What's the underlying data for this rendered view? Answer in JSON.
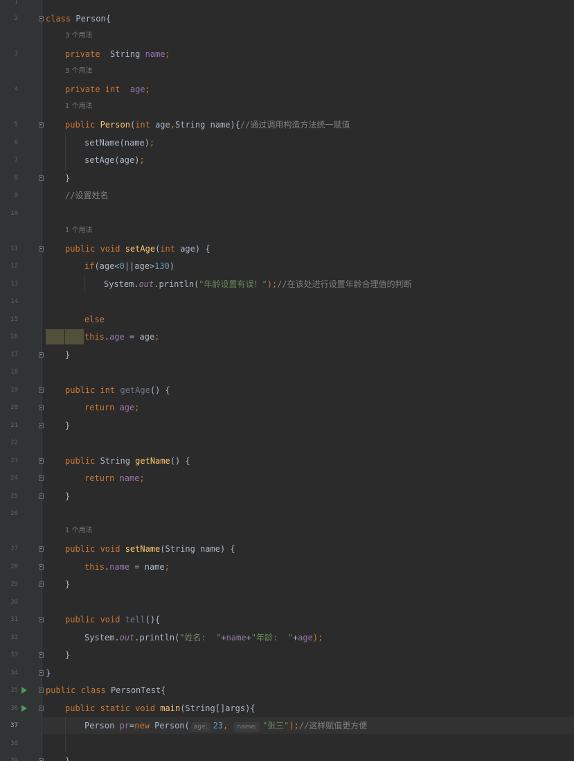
{
  "editor": {
    "current_line": 37,
    "lines": [
      {
        "n": 1
      },
      {
        "n": 2,
        "tokens": [
          {
            "t": "class ",
            "c": "kw"
          },
          {
            "t": "Person{"
          }
        ]
      },
      {
        "n": 3,
        "hint": "3 个用法",
        "tokens": [
          {
            "t": "private  ",
            "c": "kw"
          },
          {
            "t": "String "
          },
          {
            "t": "name",
            "c": "fld"
          },
          {
            "t": ";",
            "c": "kw"
          }
        ]
      },
      {
        "n": 4,
        "hint": "3 个用法",
        "tokens": [
          {
            "t": "private ",
            "c": "kw"
          },
          {
            "t": "int  ",
            "c": "kw"
          },
          {
            "t": "age",
            "c": "fld"
          },
          {
            "t": ";",
            "c": "kw"
          }
        ]
      },
      {
        "n": 5,
        "hint": "1 个用法",
        "tokens": [
          {
            "t": "public ",
            "c": "kw"
          },
          {
            "t": "Person",
            "c": "fn"
          },
          {
            "t": "("
          },
          {
            "t": "int ",
            "c": "kw"
          },
          {
            "t": "age"
          },
          {
            "t": ",",
            "c": "kw"
          },
          {
            "t": "String name){"
          },
          {
            "t": "//通过调用构造方法统一赋值",
            "c": "cmt"
          }
        ]
      },
      {
        "n": 6,
        "tokens": [
          {
            "t": "setName(name)"
          },
          {
            "t": ";",
            "c": "kw"
          }
        ]
      },
      {
        "n": 7,
        "tokens": [
          {
            "t": "setAge(age)"
          },
          {
            "t": ";",
            "c": "kw"
          }
        ]
      },
      {
        "n": 8,
        "tokens": [
          {
            "t": "}"
          }
        ]
      },
      {
        "n": 9,
        "tokens": [
          {
            "t": "//设置姓名",
            "c": "cmt"
          }
        ]
      },
      {
        "n": 10
      },
      {
        "n": 11,
        "hint": "1 个用法",
        "tokens": [
          {
            "t": "public ",
            "c": "kw"
          },
          {
            "t": "void ",
            "c": "kw"
          },
          {
            "t": "setAge",
            "c": "fn"
          },
          {
            "t": "("
          },
          {
            "t": "int ",
            "c": "kw"
          },
          {
            "t": "age) {"
          }
        ]
      },
      {
        "n": 12,
        "tokens": [
          {
            "t": "if",
            "c": "kw"
          },
          {
            "t": "(age<"
          },
          {
            "t": "0",
            "c": "num"
          },
          {
            "t": "||age>"
          },
          {
            "t": "130",
            "c": "num"
          },
          {
            "t": ")"
          }
        ]
      },
      {
        "n": 13,
        "tokens": [
          {
            "t": "System."
          },
          {
            "t": "out",
            "c": "fldi"
          },
          {
            "t": ".println("
          },
          {
            "t": "\"年龄设置有误！\"",
            "c": "str"
          },
          {
            "t": ");",
            "c": "kw"
          },
          {
            "t": "//在该处进行设置年龄合理值的判断",
            "c": "cmt"
          }
        ]
      },
      {
        "n": 14
      },
      {
        "n": 15,
        "tokens": [
          {
            "t": "else",
            "c": "kw"
          }
        ]
      },
      {
        "n": 16,
        "tokens": [
          {
            "t": "this",
            "c": "kw"
          },
          {
            "t": "."
          },
          {
            "t": "age",
            "c": "fld"
          },
          {
            "t": " = age"
          },
          {
            "t": ";",
            "c": "kw"
          }
        ]
      },
      {
        "n": 17,
        "tokens": [
          {
            "t": "}"
          }
        ]
      },
      {
        "n": 18
      },
      {
        "n": 19,
        "tokens": [
          {
            "t": "public ",
            "c": "kw"
          },
          {
            "t": "int ",
            "c": "kw"
          },
          {
            "t": "getAge",
            "c": "dim"
          },
          {
            "t": "() {"
          }
        ]
      },
      {
        "n": 20,
        "tokens": [
          {
            "t": "return ",
            "c": "kw"
          },
          {
            "t": "age",
            "c": "fld"
          },
          {
            "t": ";",
            "c": "kw"
          }
        ]
      },
      {
        "n": 21,
        "tokens": [
          {
            "t": "}"
          }
        ]
      },
      {
        "n": 22
      },
      {
        "n": 23,
        "tokens": [
          {
            "t": "public ",
            "c": "kw"
          },
          {
            "t": "String "
          },
          {
            "t": "getName",
            "c": "fn"
          },
          {
            "t": "() {"
          }
        ]
      },
      {
        "n": 24,
        "tokens": [
          {
            "t": "return ",
            "c": "kw"
          },
          {
            "t": "name",
            "c": "fld"
          },
          {
            "t": ";",
            "c": "kw"
          }
        ]
      },
      {
        "n": 25,
        "tokens": [
          {
            "t": "}"
          }
        ]
      },
      {
        "n": 26
      },
      {
        "n": 27,
        "hint": "1 个用法",
        "tokens": [
          {
            "t": "public ",
            "c": "kw"
          },
          {
            "t": "void ",
            "c": "kw"
          },
          {
            "t": "setName",
            "c": "fn"
          },
          {
            "t": "(String name) {"
          }
        ]
      },
      {
        "n": 28,
        "tokens": [
          {
            "t": "this",
            "c": "kw"
          },
          {
            "t": "."
          },
          {
            "t": "name",
            "c": "fld"
          },
          {
            "t": " = name"
          },
          {
            "t": ";",
            "c": "kw"
          }
        ]
      },
      {
        "n": 29,
        "tokens": [
          {
            "t": "}"
          }
        ]
      },
      {
        "n": 30
      },
      {
        "n": 31,
        "tokens": [
          {
            "t": "public ",
            "c": "kw"
          },
          {
            "t": "void ",
            "c": "kw"
          },
          {
            "t": "tell",
            "c": "dim"
          },
          {
            "t": "(){"
          }
        ]
      },
      {
        "n": 32,
        "tokens": [
          {
            "t": "System."
          },
          {
            "t": "out",
            "c": "fldi"
          },
          {
            "t": ".println("
          },
          {
            "t": "\"姓名:  \"",
            "c": "str"
          },
          {
            "t": "+"
          },
          {
            "t": "name",
            "c": "fld"
          },
          {
            "t": "+"
          },
          {
            "t": "\"年龄:  \"",
            "c": "str"
          },
          {
            "t": "+"
          },
          {
            "t": "age",
            "c": "fld"
          },
          {
            "t": ");",
            "c": "kw"
          }
        ]
      },
      {
        "n": 33,
        "tokens": [
          {
            "t": "}"
          }
        ]
      },
      {
        "n": 34,
        "tokens": [
          {
            "t": "}"
          }
        ]
      },
      {
        "n": 35,
        "tokens": [
          {
            "t": "public ",
            "c": "kw"
          },
          {
            "t": "class ",
            "c": "kw"
          },
          {
            "t": "PersonTest{"
          }
        ]
      },
      {
        "n": 36,
        "tokens": [
          {
            "t": "public ",
            "c": "kw"
          },
          {
            "t": "static ",
            "c": "kw"
          },
          {
            "t": "void ",
            "c": "kw"
          },
          {
            "t": "main",
            "c": "fn"
          },
          {
            "t": "(String[]args){"
          }
        ]
      },
      {
        "n": 37,
        "tokens": [
          {
            "t": "Person "
          },
          {
            "t": "pr",
            "c": "fld"
          },
          {
            "t": "="
          },
          {
            "t": "new ",
            "c": "kw"
          },
          {
            "t": "Person("
          },
          {
            "inlay": "age:"
          },
          {
            "t": "23",
            "c": "num"
          },
          {
            "t": ", ",
            "c": "kw"
          },
          {
            "inlay": "name:"
          },
          {
            "t": "\"张三\"",
            "c": "str"
          },
          {
            "t": ");",
            "c": "kw"
          },
          {
            "t": "//这样赋值更方便",
            "c": "cmt"
          }
        ]
      },
      {
        "n": 38
      },
      {
        "n": 39,
        "tokens": [
          {
            "t": "}"
          }
        ]
      }
    ]
  }
}
